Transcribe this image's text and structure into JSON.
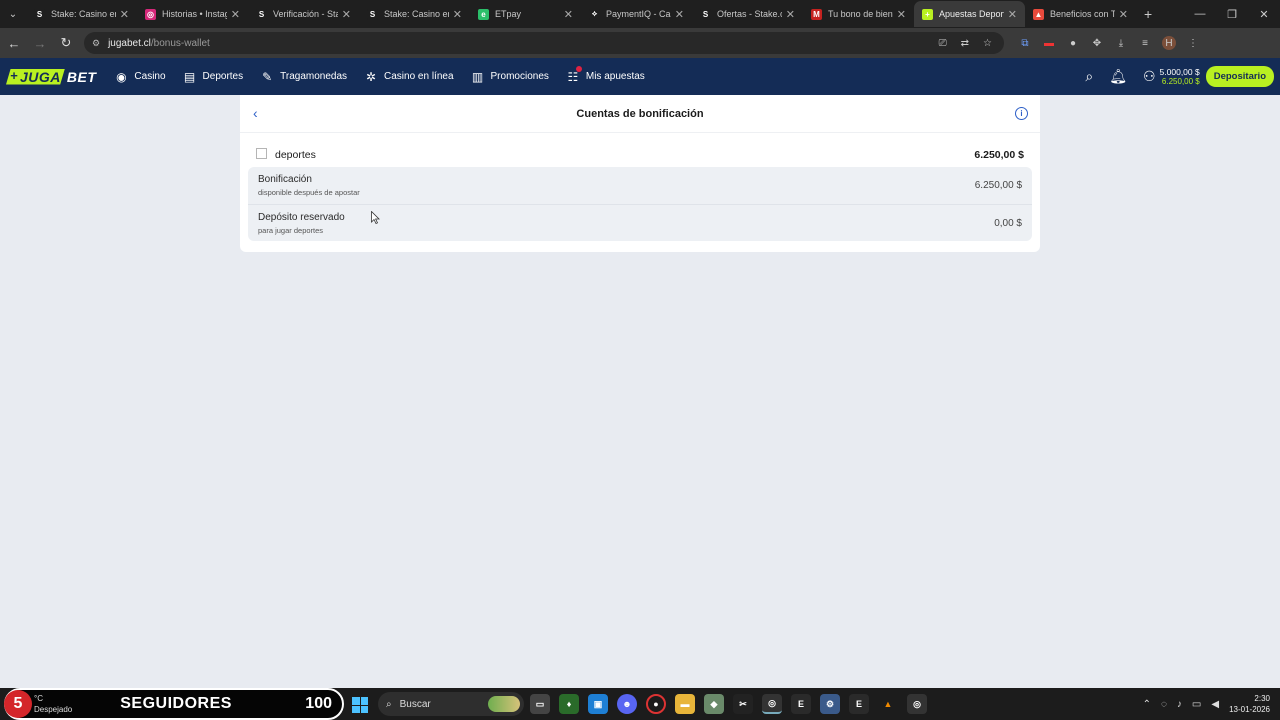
{
  "browser": {
    "tabs": [
      {
        "title": "Stake: Casino en l",
        "fav": "S",
        "color": "#1f1f1f",
        "active": false
      },
      {
        "title": "Historias • Instagr",
        "fav": "◎",
        "color": "#d6287a",
        "active": false
      },
      {
        "title": "Verificación - Stak",
        "fav": "S",
        "color": "#1f1f1f",
        "active": false
      },
      {
        "title": "Stake: Casino en l",
        "fav": "S",
        "color": "#1f1f1f",
        "active": false
      },
      {
        "title": "ETpay",
        "fav": "e",
        "color": "#2bbf6a",
        "active": false
      },
      {
        "title": "PaymentIQ - Cash",
        "fav": "⟡",
        "color": "#1f1f1f",
        "active": false
      },
      {
        "title": "Ofertas - Stake.co",
        "fav": "S",
        "color": "#1f1f1f",
        "active": false
      },
      {
        "title": "Tu bono de bienv",
        "fav": "M",
        "color": "#c5221f",
        "active": false
      },
      {
        "title": "Apuestas Deporti",
        "fav": "+",
        "color": "#b9f021",
        "active": true
      },
      {
        "title": "Beneficios con Ta",
        "fav": "▲",
        "color": "#e84a3c",
        "active": false
      }
    ],
    "url_host": "jugabet.cl",
    "url_path": "/bonus-wallet"
  },
  "site": {
    "logo_a": "JUGA",
    "logo_b": "BET",
    "nav": [
      {
        "label": "Casino",
        "icon": "casino-icon",
        "glyph": "◉"
      },
      {
        "label": "Deportes",
        "icon": "sports-icon",
        "glyph": "▤"
      },
      {
        "label": "Tragamonedas",
        "icon": "slots-icon",
        "glyph": "✎"
      },
      {
        "label": "Casino en línea",
        "icon": "live-casino-icon",
        "glyph": "✲"
      },
      {
        "label": "Promociones",
        "icon": "gift-icon",
        "glyph": "▥"
      },
      {
        "label": "Mis apuestas",
        "icon": "bets-icon",
        "glyph": "☷"
      }
    ],
    "balance_main": "5.000,00 $",
    "balance_bonus": "6.250,00 $",
    "deposit_label": "Depositario"
  },
  "wallet": {
    "title": "Cuentas de bonificación",
    "category": "deportes",
    "category_total": "6.250,00 $",
    "rows": [
      {
        "label": "Bonificación",
        "sub": "disponible después de apostar",
        "value": "6.250,00 $"
      },
      {
        "label": "Depósito reservado",
        "sub": "para jugar deportes",
        "value": "0,00 $"
      }
    ]
  },
  "taskbar": {
    "badge_number": "5",
    "weather_temp": "°C",
    "weather_desc": "Despejado",
    "followers_label": "SEGUIDORES",
    "followers_count": "100",
    "search_placeholder": "Buscar",
    "time": "2:30",
    "date": "13-01-2026"
  }
}
